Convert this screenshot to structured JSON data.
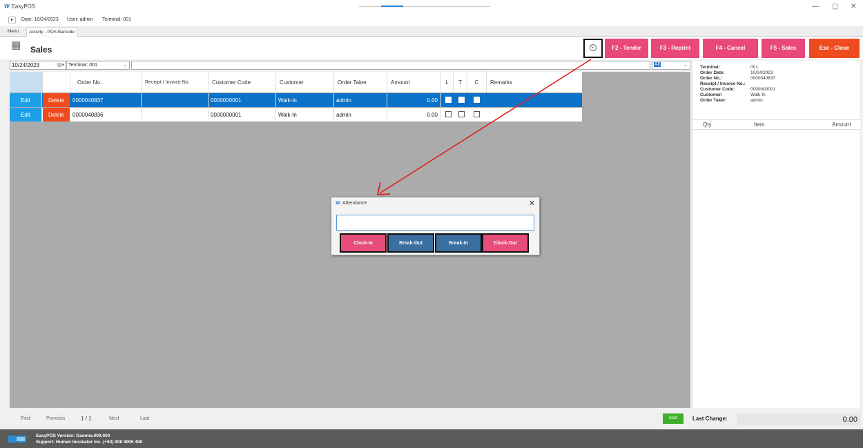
{
  "titlebar": {
    "app_name": "EasyPOS",
    "min_glyph": "—",
    "max_glyph": "▢",
    "close_glyph": "✕"
  },
  "infobar": {
    "toggle": "▸",
    "date": "Date: 10/24/2023",
    "user": "User: admin",
    "terminal": "Terminal: 001"
  },
  "tabs": [
    {
      "label": "Menu"
    },
    {
      "label": "Activity - POS Barcode"
    }
  ],
  "header": {
    "title": "Sales",
    "buttons": [
      {
        "label": "F2 - Tender",
        "color": "#e8487a"
      },
      {
        "label": "F3 - Reprint",
        "color": "#e8487a"
      },
      {
        "label": "F4 - Cancel",
        "color": "#e8487a"
      },
      {
        "label": "F5 - Sales",
        "color": "#e8487a"
      },
      {
        "label": "Esc - Close",
        "color": "#f04b1e"
      }
    ]
  },
  "filter": {
    "date": "10/24/2023",
    "terminal": "Terminal: 001",
    "status": "All"
  },
  "table": {
    "columns": [
      "Order No.",
      "Receipt / Invoice No.",
      "Customer Code",
      "Customer",
      "Order Taker",
      "Amount",
      "L",
      "T",
      "C",
      "Remarks"
    ],
    "edit_label": "Edit",
    "delete_label": "Delete",
    "rows": [
      {
        "order_no": "0000040837",
        "receipt_no": "",
        "customer_code": "0000000001",
        "customer": "Walk-In",
        "order_taker": "admin",
        "amount": "0.00",
        "l": true,
        "t": true,
        "c": true,
        "remarks": ""
      },
      {
        "order_no": "0000040836",
        "receipt_no": "",
        "customer_code": "0000000001",
        "customer": "Walk-In",
        "order_taker": "admin",
        "amount": "0.00",
        "l": false,
        "t": false,
        "c": false,
        "remarks": ""
      }
    ]
  },
  "details": {
    "terminal_label": "Terminal:",
    "terminal": "001",
    "order_date_label": "Order Date:",
    "order_date": "10/24/2023",
    "order_no_label": "Order No.:",
    "order_no": "0000040837",
    "receipt_label": "Receipt / Invoice No.:",
    "customer_code_label": "Customer Code:",
    "customer_code": "0000000001",
    "customer_label": "Customer:",
    "customer": "Walk-In",
    "order_taker_label": "Order Taker:",
    "order_taker": "admin",
    "item_columns": [
      "Qty.",
      "Item",
      "Amount"
    ]
  },
  "footer": {
    "first": "First",
    "previous": "Previous",
    "page": "1 / 1",
    "next": "Next",
    "last": "Last",
    "start": "Start",
    "last_change_label": "Last Change:",
    "last_change_value": "0.00"
  },
  "status": {
    "version": "EasyPOS Version: Gamma.009.000",
    "support": "Support: Human Incubator Inc. (+63) 908 8906 496"
  },
  "dialog": {
    "title": "Attendance",
    "close_glyph": "✕",
    "input_value": "",
    "buttons": [
      {
        "label": "Clock-In",
        "style": "pink"
      },
      {
        "label": "Break-Out",
        "style": "blue"
      },
      {
        "label": "Break-In",
        "style": "blue"
      },
      {
        "label": "Clock-Out",
        "style": "pink"
      }
    ]
  },
  "colors": {
    "accent_blue": "#0a72c8",
    "edit_blue": "#1ea0e8",
    "delete_orange": "#f04b1e",
    "pink": "#e8487a",
    "arrow_red": "#e02020"
  }
}
